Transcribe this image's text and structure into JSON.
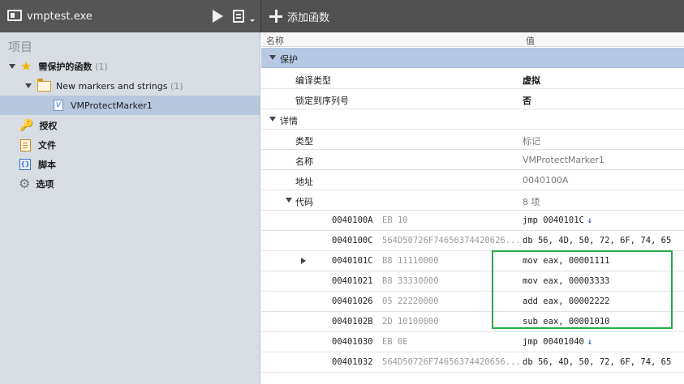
{
  "app": {
    "title": "vmptest.exe"
  },
  "toolbar": {
    "add_function_label": "添加函数"
  },
  "sidebar": {
    "header": "项目",
    "tree": {
      "protected_functions": {
        "label": "需保护的函数",
        "count": "(1)"
      },
      "folder": {
        "label": "New markers and strings",
        "count": "(1)"
      },
      "marker": {
        "label": "VMProtectMarker1"
      }
    },
    "items": [
      {
        "label": "授权",
        "icon": "key-icon"
      },
      {
        "label": "文件",
        "icon": "file-icon"
      },
      {
        "label": "脚本",
        "icon": "script-icon"
      },
      {
        "label": "选项",
        "icon": "gear-icon"
      }
    ]
  },
  "grid": {
    "headers": {
      "name": "名称",
      "value": "值"
    },
    "protection": {
      "group_label": "保护",
      "rows": [
        {
          "name": "编译类型",
          "value": "虚拟"
        },
        {
          "name": "锁定到序列号",
          "value": "否"
        }
      ]
    },
    "details": {
      "group_label": "详情",
      "rows": [
        {
          "name": "类型",
          "value": "标记"
        },
        {
          "name": "名称",
          "value": "VMProtectMarker1"
        },
        {
          "name": "地址",
          "value": "0040100A"
        }
      ],
      "code": {
        "label": "代码",
        "value": "8 项",
        "lines": [
          {
            "addr": "0040100A",
            "bytes": "EB 10",
            "asm": "jmp 0040101C",
            "jump": true
          },
          {
            "addr": "0040100C",
            "bytes": "564D50726F74656374420626...",
            "asm": "db 56, 4D, 50, 72, 6F, 74, 65",
            "jump": false
          },
          {
            "addr": "0040101C",
            "bytes": "B8 11110000",
            "asm": "mov eax, 00001111",
            "jump": false,
            "current": true
          },
          {
            "addr": "00401021",
            "bytes": "B8 33330000",
            "asm": "mov eax, 00003333",
            "jump": false
          },
          {
            "addr": "00401026",
            "bytes": "05 22220000",
            "asm": "add eax, 00002222",
            "jump": false
          },
          {
            "addr": "0040102B",
            "bytes": "2D 10100000",
            "asm": "sub eax, 00001010",
            "jump": false
          },
          {
            "addr": "00401030",
            "bytes": "EB 0E",
            "asm": "jmp 00401040",
            "jump": true
          },
          {
            "addr": "00401032",
            "bytes": "564D50726F74656374420656...",
            "asm": "db 56, 4D, 50, 72, 6F, 74, 65",
            "jump": false
          }
        ]
      }
    }
  },
  "colors": {
    "selected_row": "#b6c7de",
    "highlight_box": "#2aa84a",
    "jump_arrow": "#2b52c8"
  }
}
